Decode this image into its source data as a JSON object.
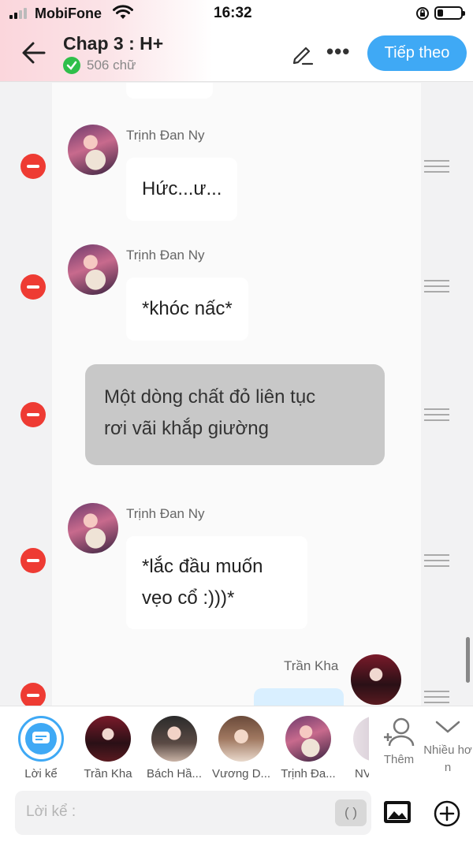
{
  "status_bar": {
    "carrier": "MobiFone",
    "time": "16:32"
  },
  "header": {
    "title": "Chap 3 : H+",
    "word_count": "506 chữ",
    "next_button": "Tiếp theo"
  },
  "messages": [
    {
      "type": "character",
      "name": "Trịnh Đan Ny",
      "text": "Hức...ư..."
    },
    {
      "type": "character",
      "name": "Trịnh Đan Ny",
      "text": "*khóc nấc*"
    },
    {
      "type": "narration",
      "text_line1": "Một dòng chất đỏ liên tục",
      "text_line2": "rơi vãi khắp giường"
    },
    {
      "type": "character",
      "name": "Trịnh Đan Ny",
      "text_line1": "*lắc đầu muốn",
      "text_line2": "vẹo cổ :)))*"
    },
    {
      "type": "character-right",
      "name": "Trần Kha",
      "text": ""
    }
  ],
  "characters": [
    {
      "label": "Lời kể",
      "icon": "narrator-icon",
      "selected": true
    },
    {
      "label": "Trần Kha",
      "icon": "avatar"
    },
    {
      "label": "Bách Hầ...",
      "icon": "avatar"
    },
    {
      "label": "Vương D...",
      "icon": "avatar"
    },
    {
      "label": "Trịnh Đa...",
      "icon": "avatar"
    },
    {
      "label": "NV",
      "icon": "avatar"
    }
  ],
  "add_character": {
    "label": "Thêm",
    "icon": "add-person-icon"
  },
  "more_characters": {
    "label": "Nhiều hơn",
    "icon": "chevron-down-icon"
  },
  "input": {
    "placeholder": "Lời kể :",
    "toggle": "( )"
  },
  "colors": {
    "accent": "#3fa9f5",
    "delete": "#ee3b33",
    "narration_bg": "#c8c8c8"
  }
}
